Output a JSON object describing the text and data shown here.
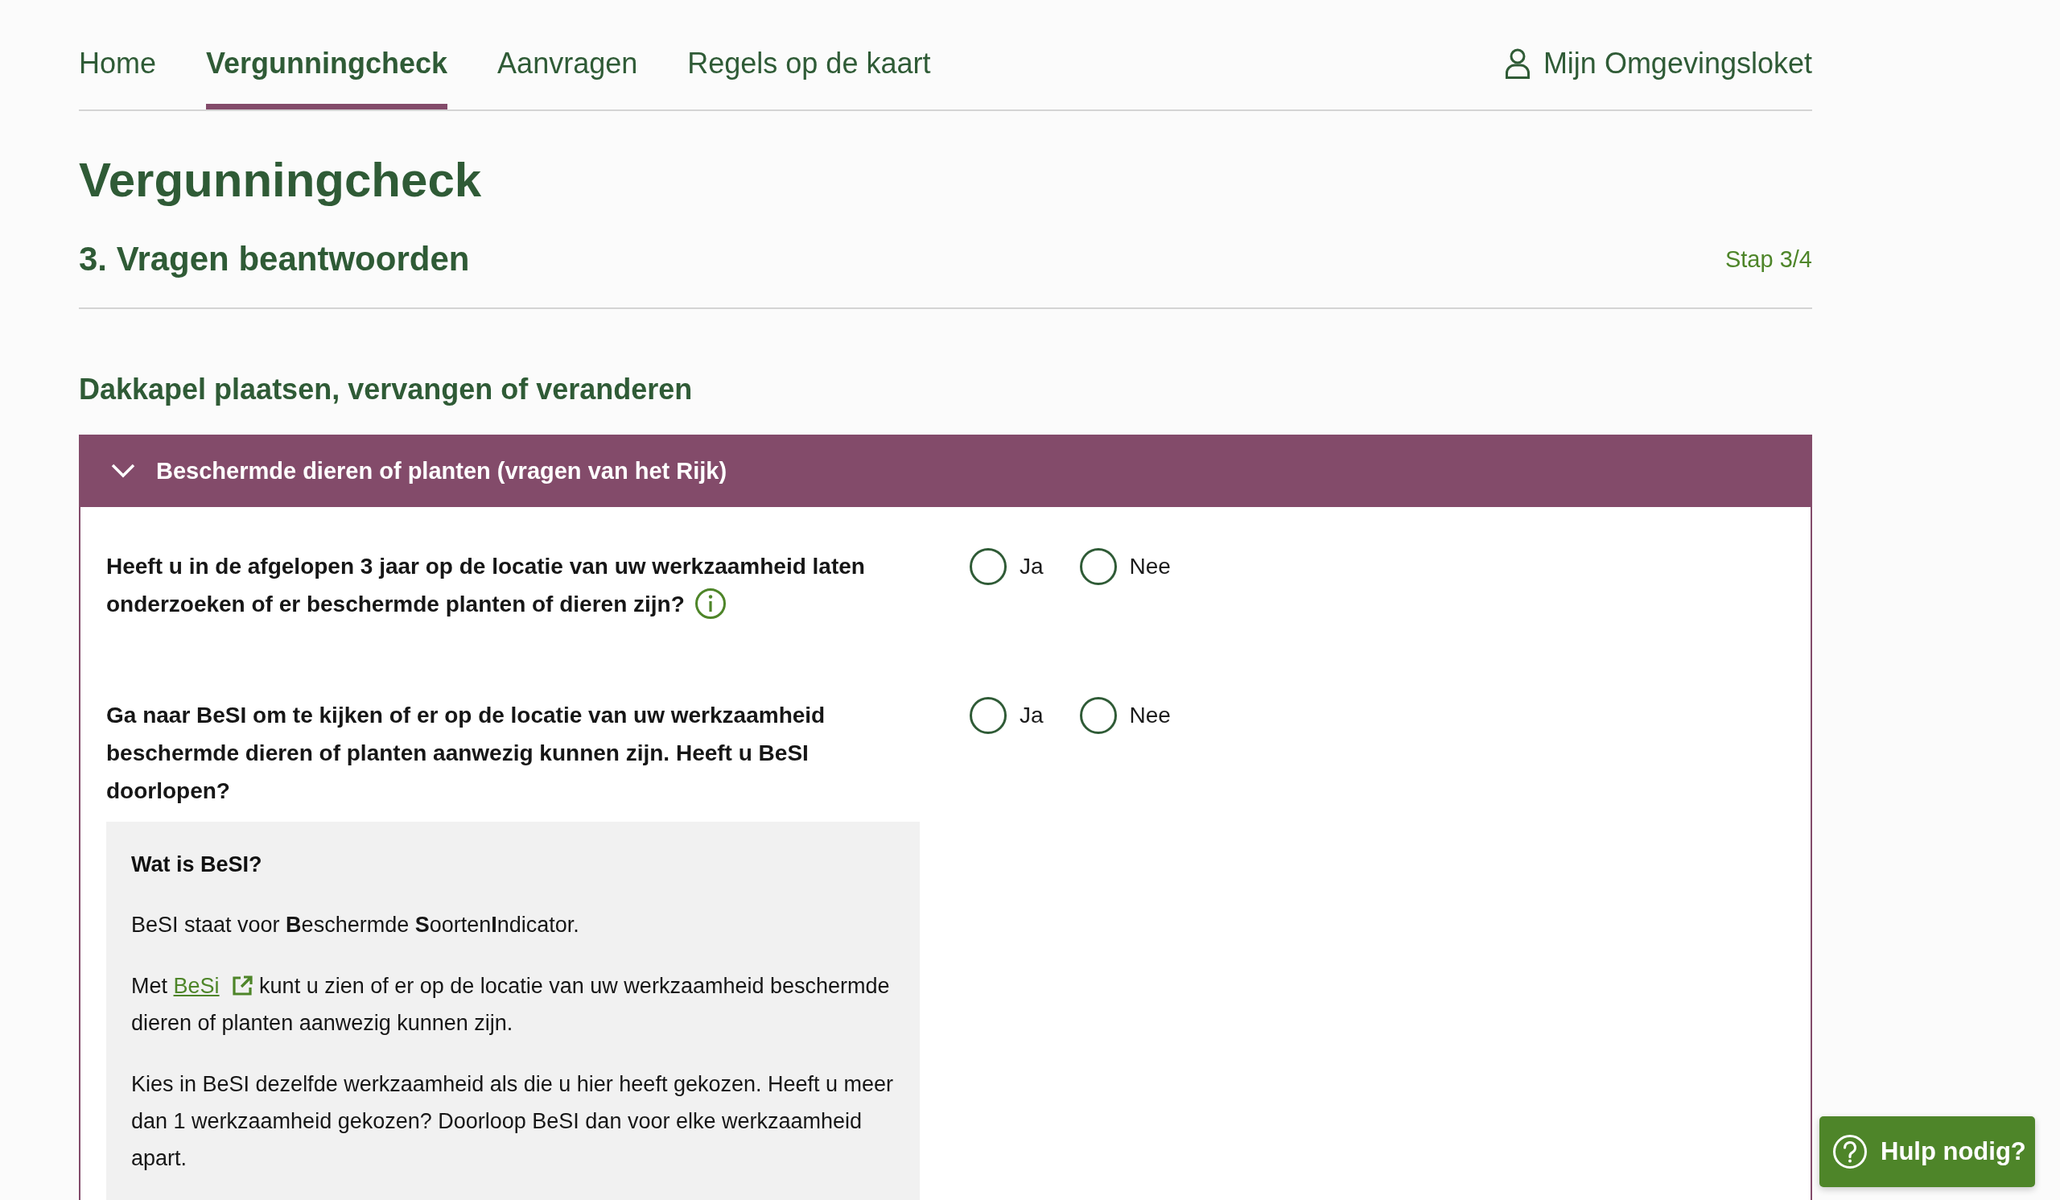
{
  "nav": {
    "tabs": [
      {
        "label": "Home",
        "selected": false
      },
      {
        "label": "Vergunningcheck",
        "selected": true
      },
      {
        "label": "Aanvragen",
        "selected": false
      },
      {
        "label": "Regels op de kaart",
        "selected": false
      }
    ],
    "account_link": "Mijn Omgevingsloket"
  },
  "page_title": "Vergunningcheck",
  "step": {
    "title": "3. Vragen beantwoorden",
    "indicator": "Stap 3/4"
  },
  "section_title": "Dakkapel plaatsen, vervangen of veranderen",
  "accordion": {
    "title": "Beschermde dieren of planten (vragen van het Rijk)",
    "expanded": true,
    "questions": [
      {
        "text": "Heeft u in de afgelopen 3 jaar op de locatie van uw werkzaamheid laten onderzoeken of er beschermde planten of dieren zijn?",
        "info": true,
        "options": [
          {
            "label": "Ja",
            "selected": false
          },
          {
            "label": "Nee",
            "selected": false
          }
        ]
      },
      {
        "text": "Ga naar BeSI om te kijken of er op de locatie van uw werkzaamheid beschermde dieren of planten aanwezig kunnen zijn. Heeft u BeSI doorlopen?",
        "info": false,
        "options": [
          {
            "label": "Ja",
            "selected": false
          },
          {
            "label": "Nee",
            "selected": false
          }
        ],
        "explanation": {
          "title": "Wat is BeSI?",
          "paragraphs": [
            {
              "kind": "text",
              "text": "BeSI staat voor **B**eschermde **S**oorten**I**ndicator."
            },
            {
              "kind": "link",
              "before": "Met",
              "link": "BeSi",
              "after": "kunt u zien of er op de locatie van uw werkzaamheid beschermde dieren of planten aanwezig kunnen zijn."
            },
            {
              "kind": "text",
              "text": "Kies in BeSI dezelfde werkzaamheid als die u hier heeft gekozen. Heeft u meer dan 1 werkzaamheid gekozen? Doorloop BeSI dan voor elke werkzaamheid apart."
            }
          ]
        }
      }
    ]
  },
  "help_button": "Hulp nodig?"
}
